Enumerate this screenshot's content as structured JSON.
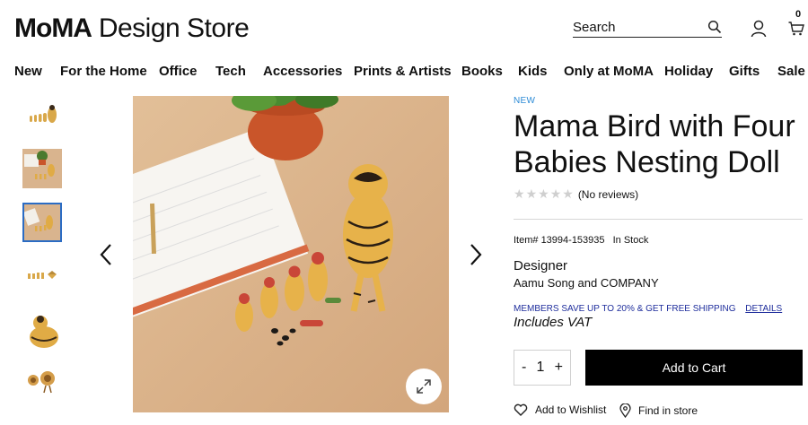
{
  "header": {
    "logo_bold": "MoMA",
    "logo_regular": "Design Store",
    "search_placeholder": "Search",
    "cart_count": "0"
  },
  "nav": [
    "New",
    "For the Home",
    "Office",
    "Tech",
    "Accessories",
    "Prints & Artists",
    "Books",
    "Kids",
    "Only at MoMA",
    "Holiday",
    "Gifts",
    "Sale"
  ],
  "gallery": {
    "selected_index": 2,
    "thumbnail_count": 6
  },
  "product": {
    "badge": "NEW",
    "title": "Mama Bird with Four Babies Nesting Doll",
    "reviews_text": "(No reviews)",
    "rating_stars": 5,
    "rating_value": 0,
    "item_number": "Item# 13994-153935",
    "stock_status": "In Stock",
    "designer_label": "Designer",
    "designer_name": "Aamu Song and COMPANY",
    "promo_text": "MEMBERS SAVE UP TO 20% & GET FREE SHIPPING",
    "promo_link": "DETAILS",
    "vat_note": "Includes VAT"
  },
  "purchase": {
    "qty_minus": "-",
    "qty_value": "1",
    "qty_plus": "+",
    "add_to_cart": "Add to Cart",
    "wishlist": "Add to Wishlist",
    "find_in_store": "Find in store"
  },
  "colors": {
    "accent_link": "#1e2d9c",
    "badge_blue": "#2c8bd6",
    "thumb_selected": "#2b6cc4",
    "cta_bg": "#000000"
  }
}
